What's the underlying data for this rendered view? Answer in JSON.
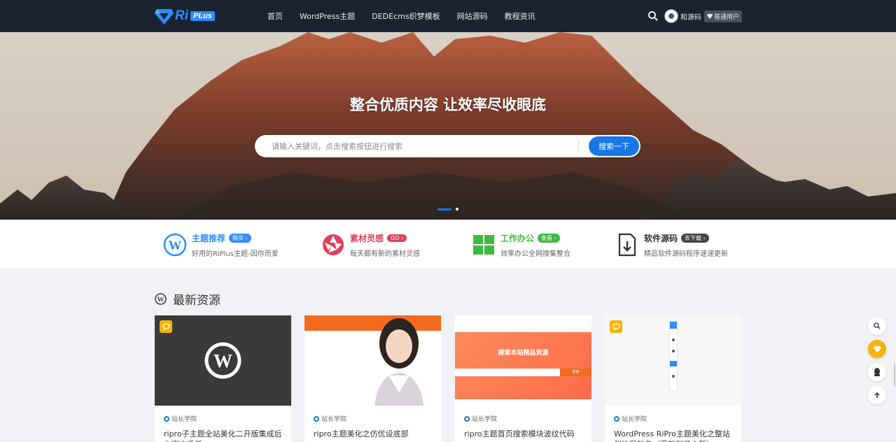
{
  "brand": {
    "logo_ri": "Ri",
    "logo_plus": "PLus"
  },
  "nav": [
    "首页",
    "WordPress主题",
    "DEDEcms织梦模板",
    "网站源码",
    "教程资讯"
  ],
  "user": {
    "name": "和源码",
    "badge": "普通用户"
  },
  "hero": {
    "title": "整合优质内容 让效率尽收眼底",
    "search_placeholder": "请输入关键词，点击搜索按钮进行搜索",
    "search_button": "搜索一下"
  },
  "features": [
    {
      "title": "主题推荐",
      "badge": "购买 ›",
      "desc": "好用的RiPlus主题-因你而爱",
      "color": "#2f8cff"
    },
    {
      "title": "素材灵感",
      "badge": "GO ›",
      "desc": "每天都有新的素材灵感",
      "color": "#e0405a"
    },
    {
      "title": "工作办公",
      "badge": "查看 ›",
      "desc": "效率办公全网搜集整合",
      "color": "#3dbb3f"
    },
    {
      "title": "软件源码",
      "badge": "去下载 ›",
      "desc": "精品软件源码程序速递更新",
      "color": "#333333"
    }
  ],
  "section": {
    "title": "最新资源"
  },
  "cards": [
    {
      "category": "站长学院",
      "title": "ripro子主题全站美化二开版集成后台官方手册"
    },
    {
      "category": "站长学院",
      "title": "ripro主题美化之仿优设底部"
    },
    {
      "category": "站长学院",
      "title": "ripro主题首页搜索模块波纹代码"
    },
    {
      "category": "站长学院",
      "title": "WordPress RiPro主题美化之整站侧边导航条（更新到子主题）"
    }
  ],
  "card3_thumb": {
    "headline": "搜索本站精品资源",
    "button": "搜索"
  },
  "colors": {
    "header_bg": "#1b2330",
    "accent": "#1677e8",
    "yellow": "#f6b500"
  }
}
